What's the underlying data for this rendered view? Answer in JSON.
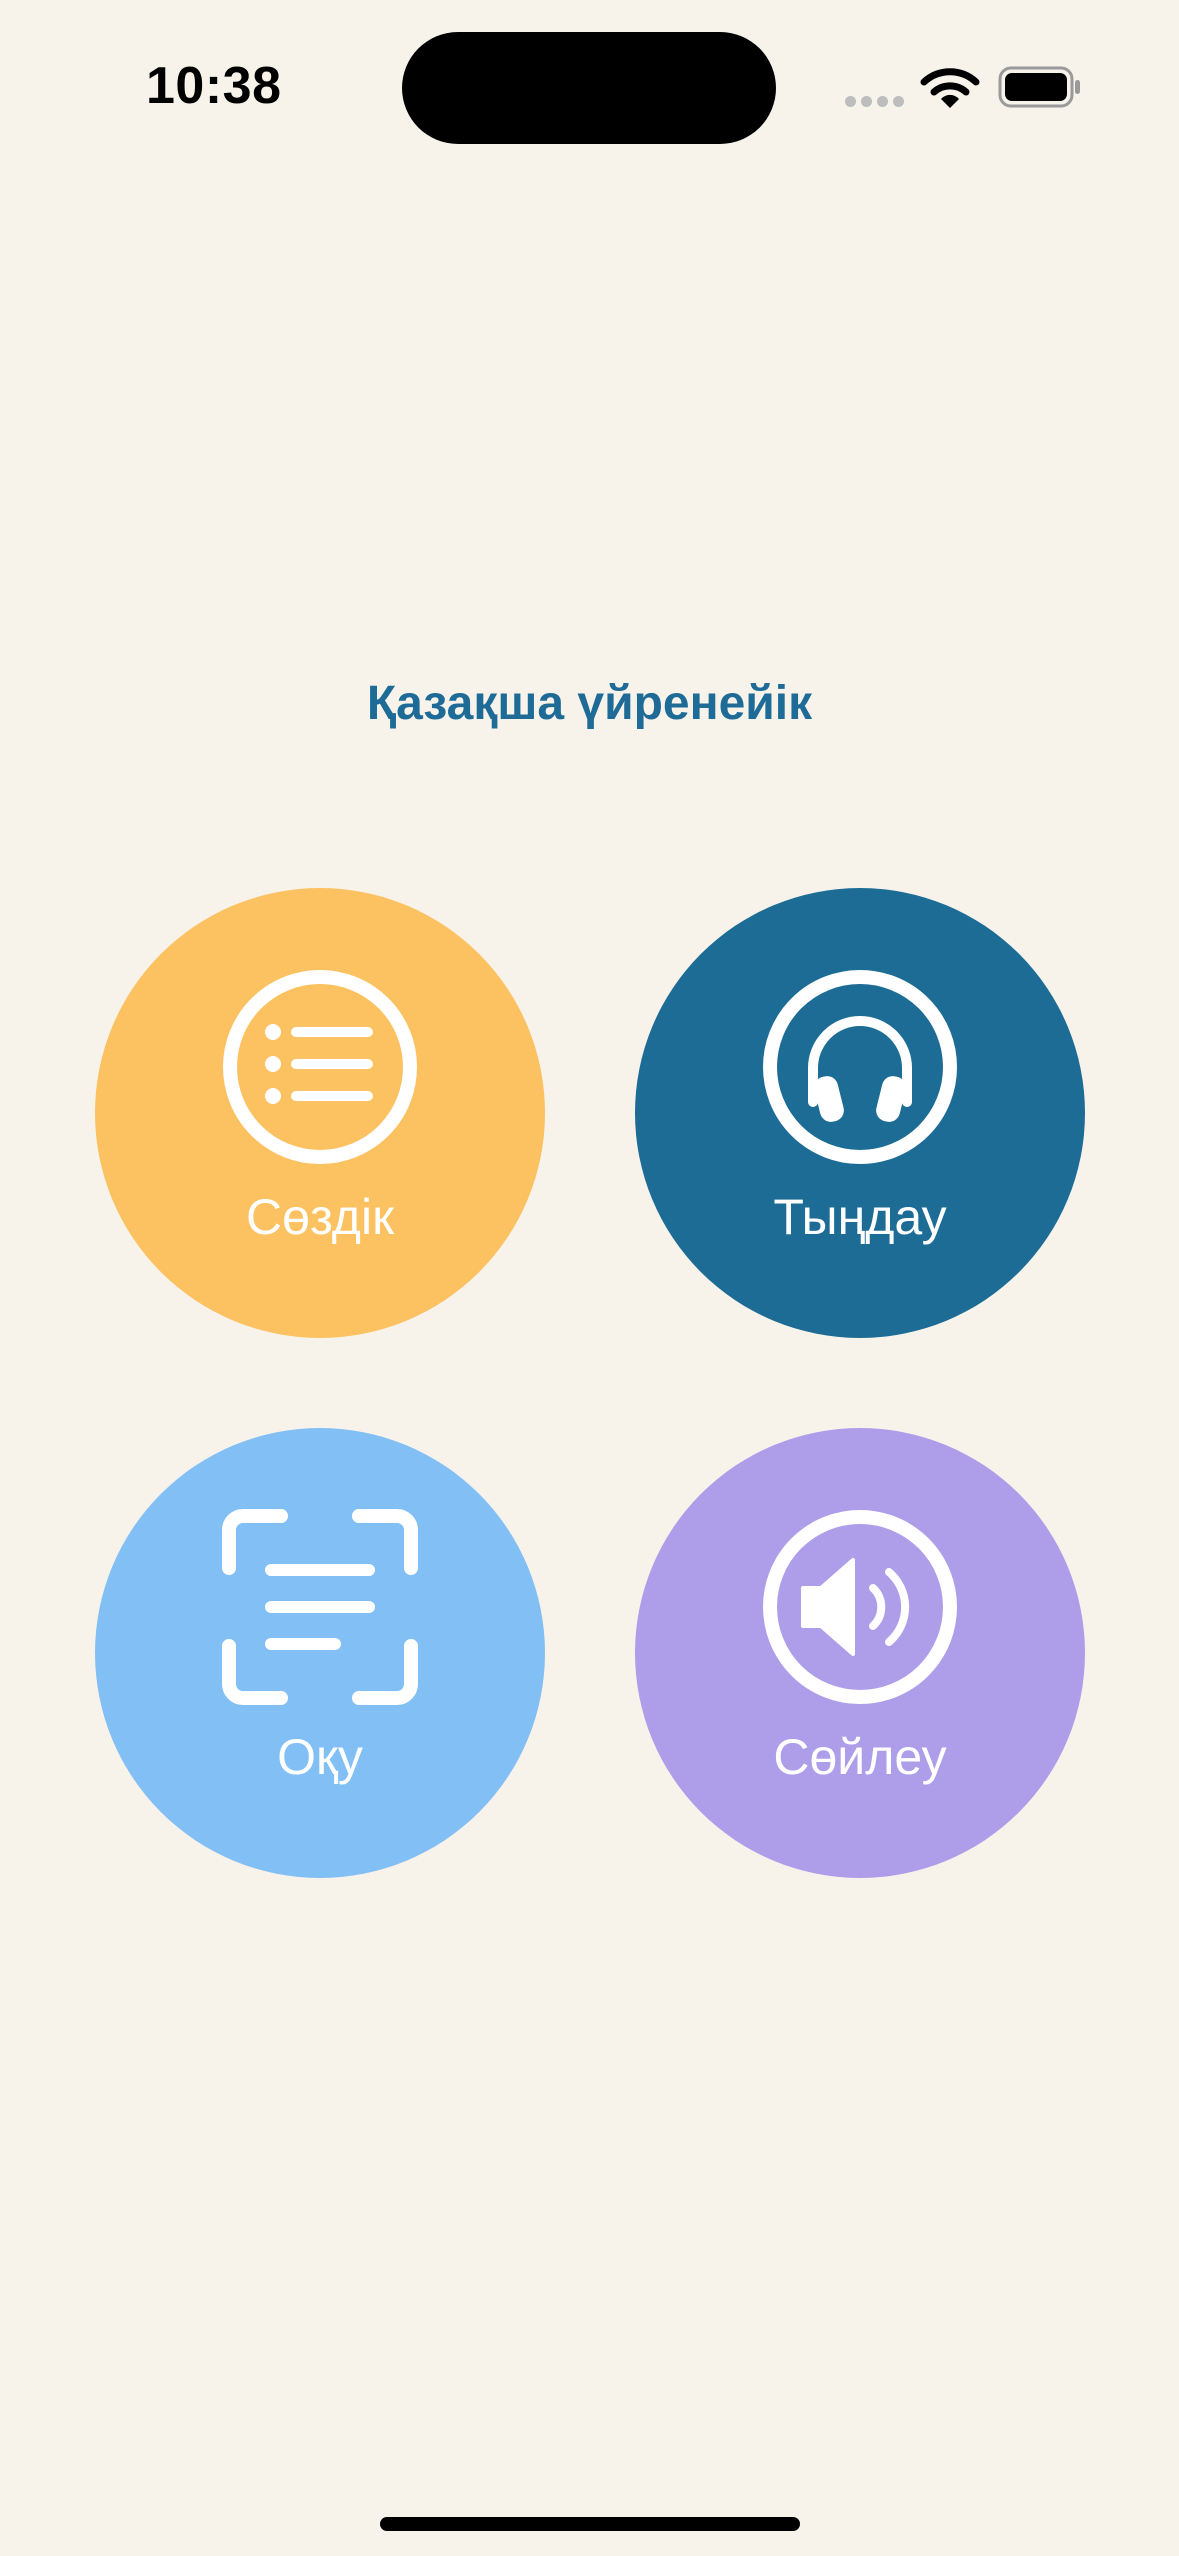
{
  "status_bar": {
    "time": "10:38",
    "icons": [
      "cellular-signal-icon",
      "wifi-icon",
      "battery-icon"
    ]
  },
  "header": {
    "title": "Қазақша үйренейік"
  },
  "menu": {
    "items": [
      {
        "label": "Сөздік",
        "icon": "list-icon",
        "color": "#fcc160"
      },
      {
        "label": "Тыңдау",
        "icon": "headphones-icon",
        "color": "#1c6c96"
      },
      {
        "label": "Оқу",
        "icon": "text-scan-icon",
        "color": "#82bff5"
      },
      {
        "label": "Сөйлеу",
        "icon": "speaker-icon",
        "color": "#ae9ee9"
      }
    ]
  },
  "colors": {
    "background": "#f7f3eb",
    "title": "#1d6b96",
    "icon_label": "#ffffff"
  }
}
